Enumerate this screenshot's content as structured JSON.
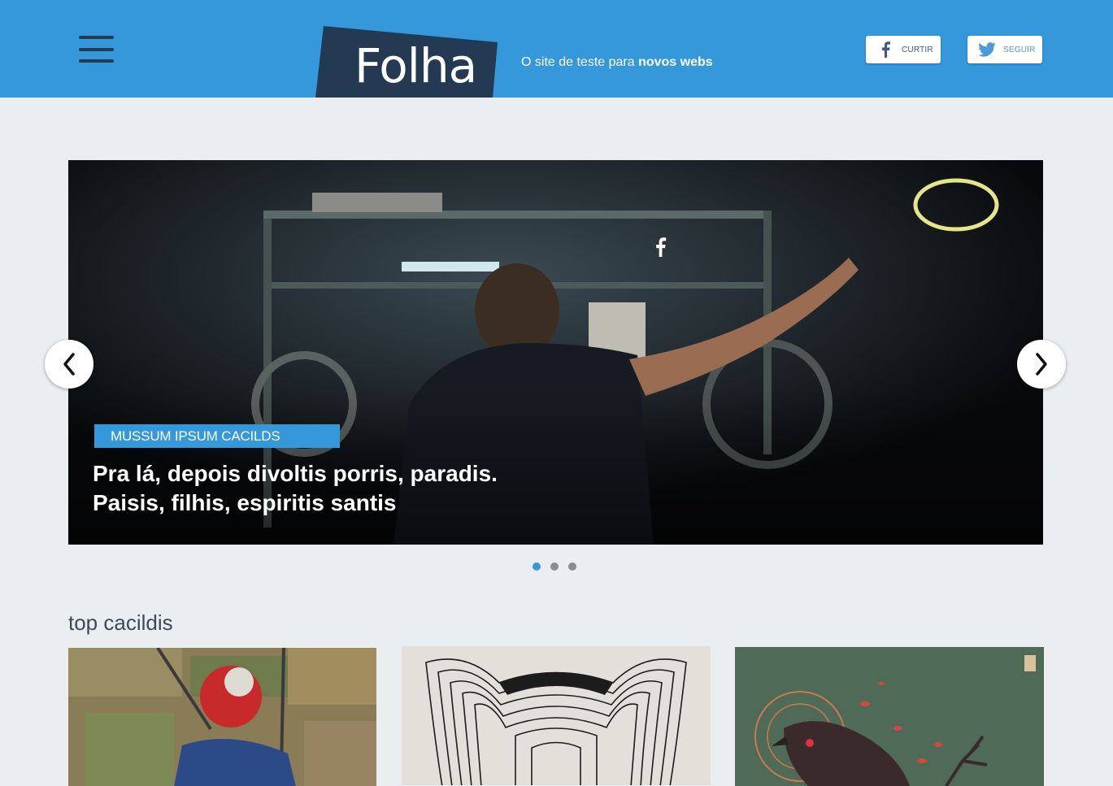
{
  "header": {
    "menu_icon": "hamburger-menu-icon",
    "logo_text": "Folha",
    "tagline_prefix": "O site de teste para ",
    "tagline_bold": "novos webs",
    "facebook_button": {
      "label": "CURTIR",
      "icon": "facebook-icon"
    },
    "twitter_button": {
      "label": "SEGUIR",
      "icon": "twitter-bird-icon"
    },
    "colors": {
      "bar": "#3498db",
      "logo_box": "#233a52"
    }
  },
  "slider": {
    "category": "MUSSUM IPSUM CACILDS",
    "title_line1": "Pra lá, depois divoltis porris, paradis.",
    "title_line2": "Paisis, filhis, espiritis santis",
    "share_icon": "facebook-icon",
    "prev_icon": "chevron-left-icon",
    "next_icon": "chevron-right-icon",
    "slide_count": 3,
    "active_slide": 1
  },
  "section": {
    "title": "top cacildis",
    "cards": [
      {
        "image": "child-on-swing-aerial-photo"
      },
      {
        "image": "line-art-animal-head-illustration"
      },
      {
        "image": "hawk-with-branch-illustration"
      }
    ]
  }
}
